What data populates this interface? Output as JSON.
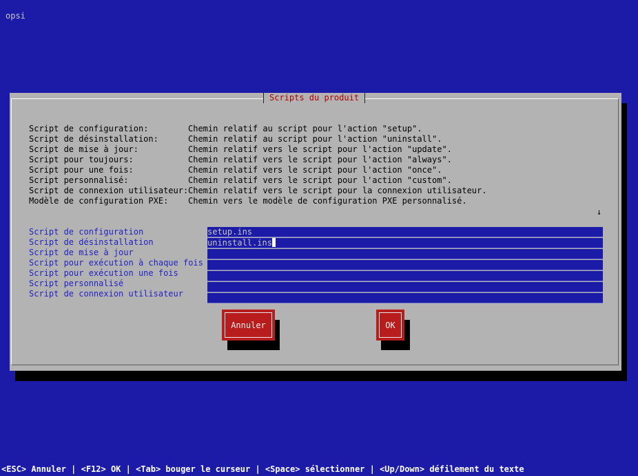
{
  "app": {
    "title": "opsi"
  },
  "dialog": {
    "title": "Scripts du produit",
    "scroll_indicator": "↓",
    "help": [
      {
        "key": "Script de configuration:",
        "desc": "Chemin relatif au script pour l'action \"setup\"."
      },
      {
        "key": "Script de désinstallation:",
        "desc": "Chemin relatif au script pour l'action \"uninstall\"."
      },
      {
        "key": "Script de mise à jour:",
        "desc": "Chemin relatif vers le script pour l'action \"update\"."
      },
      {
        "key": "Script pour toujours:",
        "desc": "Chemin relatif vers le script pour l'action \"always\"."
      },
      {
        "key": "Script pour une fois:",
        "desc": "Chemin relatif vers le script pour l'action \"once\"."
      },
      {
        "key": "Script personnalisé:",
        "desc": "Chemin relatif vers le script pour l'action \"custom\"."
      },
      {
        "key": "Script de connexion utilisateur:",
        "desc": "Chemin relatif vers le script pour la connexion utilisateur."
      },
      {
        "key": "Modèle de configuration PXE:",
        "desc": "Chemin vers le modèle de configuration PXE personnalisé."
      }
    ],
    "fields": [
      {
        "label": "Script de configuration",
        "value": "setup.ins"
      },
      {
        "label": "Script de désinstallation",
        "value": "uninstall.ins"
      },
      {
        "label": "Script de mise à jour",
        "value": ""
      },
      {
        "label": "Script pour exécution à chaque fois",
        "value": ""
      },
      {
        "label": "Script pour exécution une fois",
        "value": ""
      },
      {
        "label": "Script personnalisé",
        "value": ""
      },
      {
        "label": "Script de connexion utilisateur",
        "value": ""
      }
    ],
    "buttons": {
      "cancel_label": "Annuler",
      "ok_label": "OK"
    }
  },
  "status_bar": {
    "text": "<ESC> Annuler | <F12> OK | <Tab> bouger le curseur | <Space> sélectionner | <Up/Down> défilement du texte"
  },
  "colors": {
    "background": "#1b1ba8",
    "dialog": "#b3b3b3",
    "title": "#b20000",
    "button": "#b81c1c",
    "label": "#2323c2"
  }
}
